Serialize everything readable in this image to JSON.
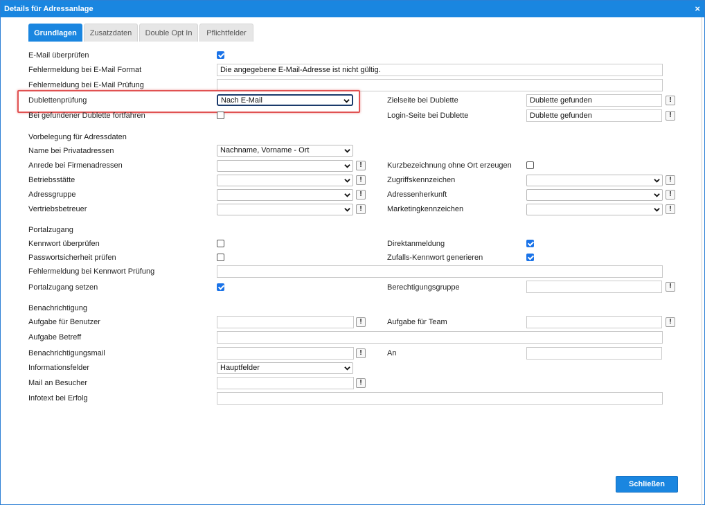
{
  "window": {
    "title": "Details für Adressanlage",
    "close_glyph": "×"
  },
  "tabs": [
    {
      "label": "Grundlagen",
      "active": true
    },
    {
      "label": "Zusatzdaten",
      "active": false
    },
    {
      "label": "Double Opt In",
      "active": false
    },
    {
      "label": "Pflichtfelder",
      "active": false
    }
  ],
  "fields": {
    "email_check": {
      "label": "E-Mail überprüfen",
      "checked": true
    },
    "email_format_error": {
      "label": "Fehlermeldung bei E-Mail Format",
      "value": "Die angegebene E-Mail-Adresse ist nicht gültig."
    },
    "email_check_error": {
      "label": "Fehlermeldung bei E-Mail Prüfung",
      "value": ""
    },
    "duplicate_check": {
      "label": "Dublettenprüfung",
      "value": "Nach E-Mail"
    },
    "duplicate_target": {
      "label": "Zielseite bei Dublette",
      "value": "Dublette gefunden"
    },
    "duplicate_continue": {
      "label": "Bei gefundener Dublette fortfahren",
      "checked": false
    },
    "duplicate_login": {
      "label": "Login-Seite bei Dublette",
      "value": "Dublette gefunden"
    }
  },
  "prefill": {
    "heading": "Vorbelegung für Adressdaten",
    "private_name": {
      "label": "Name bei Privatadressen",
      "value": "Nachname, Vorname - Ort"
    },
    "company_salutation": {
      "label": "Anrede bei Firmenadressen",
      "value": ""
    },
    "short_without_city": {
      "label": "Kurzbezeichnung ohne Ort erzeugen",
      "checked": false
    },
    "site": {
      "label": "Betriebsstätte",
      "value": ""
    },
    "access_mark": {
      "label": "Zugriffskennzeichen",
      "value": ""
    },
    "address_group": {
      "label": "Adressgruppe",
      "value": ""
    },
    "address_origin": {
      "label": "Adressenherkunft",
      "value": ""
    },
    "sales_rep": {
      "label": "Vertriebsbetreuer",
      "value": ""
    },
    "marketing_mark": {
      "label": "Marketingkennzeichen",
      "value": ""
    }
  },
  "portal": {
    "heading": "Portalzugang",
    "password_check": {
      "label": "Kennwort überprüfen",
      "checked": false
    },
    "direct_login": {
      "label": "Direktanmeldung",
      "checked": true
    },
    "password_strength": {
      "label": "Passwortsicherheit prüfen",
      "checked": false
    },
    "random_password": {
      "label": "Zufalls-Kennwort generieren",
      "checked": true
    },
    "password_error": {
      "label": "Fehlermeldung bei Kennwort Prüfung",
      "value": ""
    },
    "set_portal": {
      "label": "Portalzugang setzen",
      "checked": true
    },
    "permission_group": {
      "label": "Berechtigungsgruppe",
      "value": ""
    }
  },
  "notify": {
    "heading": "Benachrichtigung",
    "task_user": {
      "label": "Aufgabe für Benutzer",
      "value": ""
    },
    "task_team": {
      "label": "Aufgabe für Team",
      "value": ""
    },
    "task_subject": {
      "label": "Aufgabe Betreff",
      "value": ""
    },
    "notify_mail": {
      "label": "Benachrichtigungsmail",
      "value": ""
    },
    "to": {
      "label": "An",
      "value": ""
    },
    "info_fields": {
      "label": "Informationsfelder",
      "value": "Hauptfelder"
    },
    "mail_visitor": {
      "label": "Mail an Besucher",
      "value": ""
    },
    "info_success": {
      "label": "Infotext bei Erfolg",
      "value": ""
    }
  },
  "buttons": {
    "close": "Schließen"
  },
  "icons": {
    "info_button": "!"
  },
  "colors": {
    "accent": "#1a86e0",
    "highlight": "#e05252"
  }
}
